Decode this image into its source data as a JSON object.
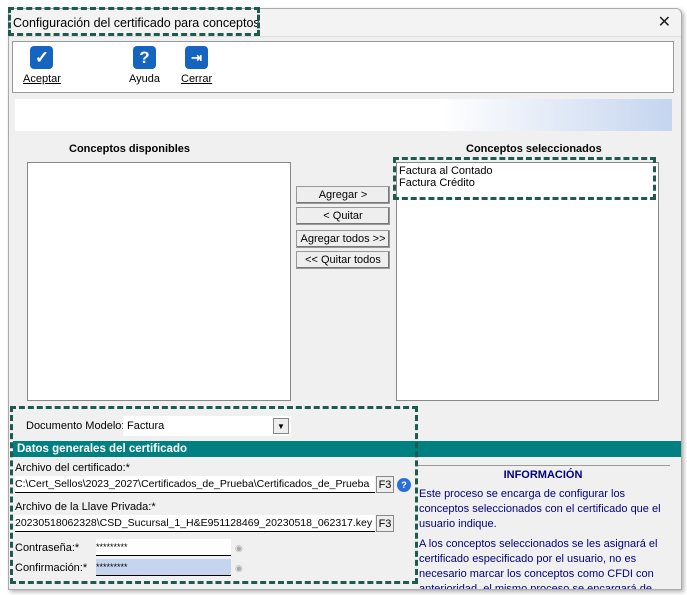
{
  "window": {
    "title": "Configuración del certificado para conceptos",
    "close": "✕"
  },
  "toolbar": {
    "accept": "Aceptar",
    "help": "Ayuda",
    "close": "Cerrar"
  },
  "available": {
    "label": "Conceptos disponibles",
    "items": []
  },
  "selected": {
    "label": "Conceptos seleccionados",
    "items": [
      "Factura al Contado",
      "Factura Crédito"
    ]
  },
  "buttons": {
    "add": "Agregar >",
    "remove": "< Quitar",
    "add_all": "Agregar todos >>",
    "remove_all": "<< Quitar todos"
  },
  "doc_model": {
    "label": "Documento Modelo:",
    "value": "Factura"
  },
  "section": "Datos generales del certificado",
  "cert": {
    "label": "Archivo del certificado:*",
    "value": "C:\\Cert_Sellos\\2023_2027\\Certificados_de_Prueba\\Certificados_de_Prueba",
    "f3": "F3"
  },
  "key": {
    "label": "Archivo de la Llave Privada:*",
    "value": "20230518062328\\CSD_Sucursal_1_H&E951128469_20230518_062317.key",
    "f3": "F3"
  },
  "password": {
    "label": "Contraseña:*",
    "value": "*********"
  },
  "confirm": {
    "label": "Confirmación:*",
    "value": "*********"
  },
  "info": {
    "title": "INFORMACIÓN",
    "p1": "Este proceso se encarga de configurar los conceptos seleccionados con el certificado que el usuario indique.",
    "p2": "A los conceptos seleccionados se les asignará el certificado especificado por el usuario, no es necesario marcar los conceptos como CFDI con anterioridad, el mismo proceso se encargará de"
  }
}
